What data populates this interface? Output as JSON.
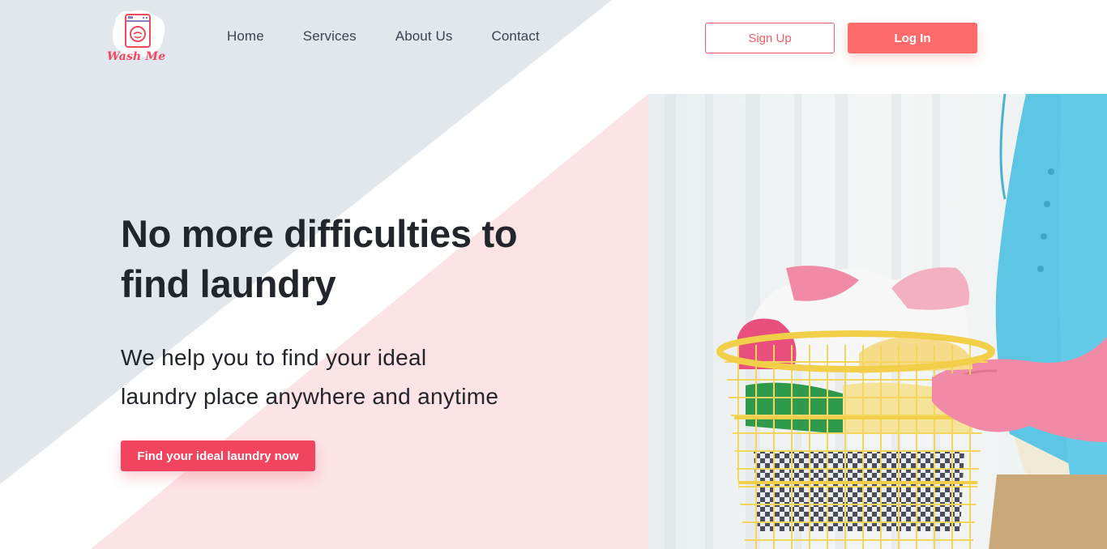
{
  "brand": {
    "name": "Wash Me",
    "icon": "washing-machine-icon",
    "color": "#f0495e"
  },
  "nav": {
    "items": [
      {
        "label": "Home"
      },
      {
        "label": "Services"
      },
      {
        "label": "About Us"
      },
      {
        "label": "Contact"
      }
    ]
  },
  "auth": {
    "signup_label": "Sign Up",
    "login_label": "Log In"
  },
  "hero": {
    "headline_line1": "No more difficulties to",
    "headline_line2": "find laundry",
    "subhead_line1": "We help you to find your ideal",
    "subhead_line2": "laundry place anywhere and anytime",
    "cta_label": "Find your ideal laundry now"
  },
  "colors": {
    "accent": "#ff6b6b",
    "cta": "#f2445e",
    "bg_gray": "#e1e7ed",
    "bg_pink": "#fce3e5"
  },
  "image": {
    "subject": "person-holding-laundry-basket"
  }
}
